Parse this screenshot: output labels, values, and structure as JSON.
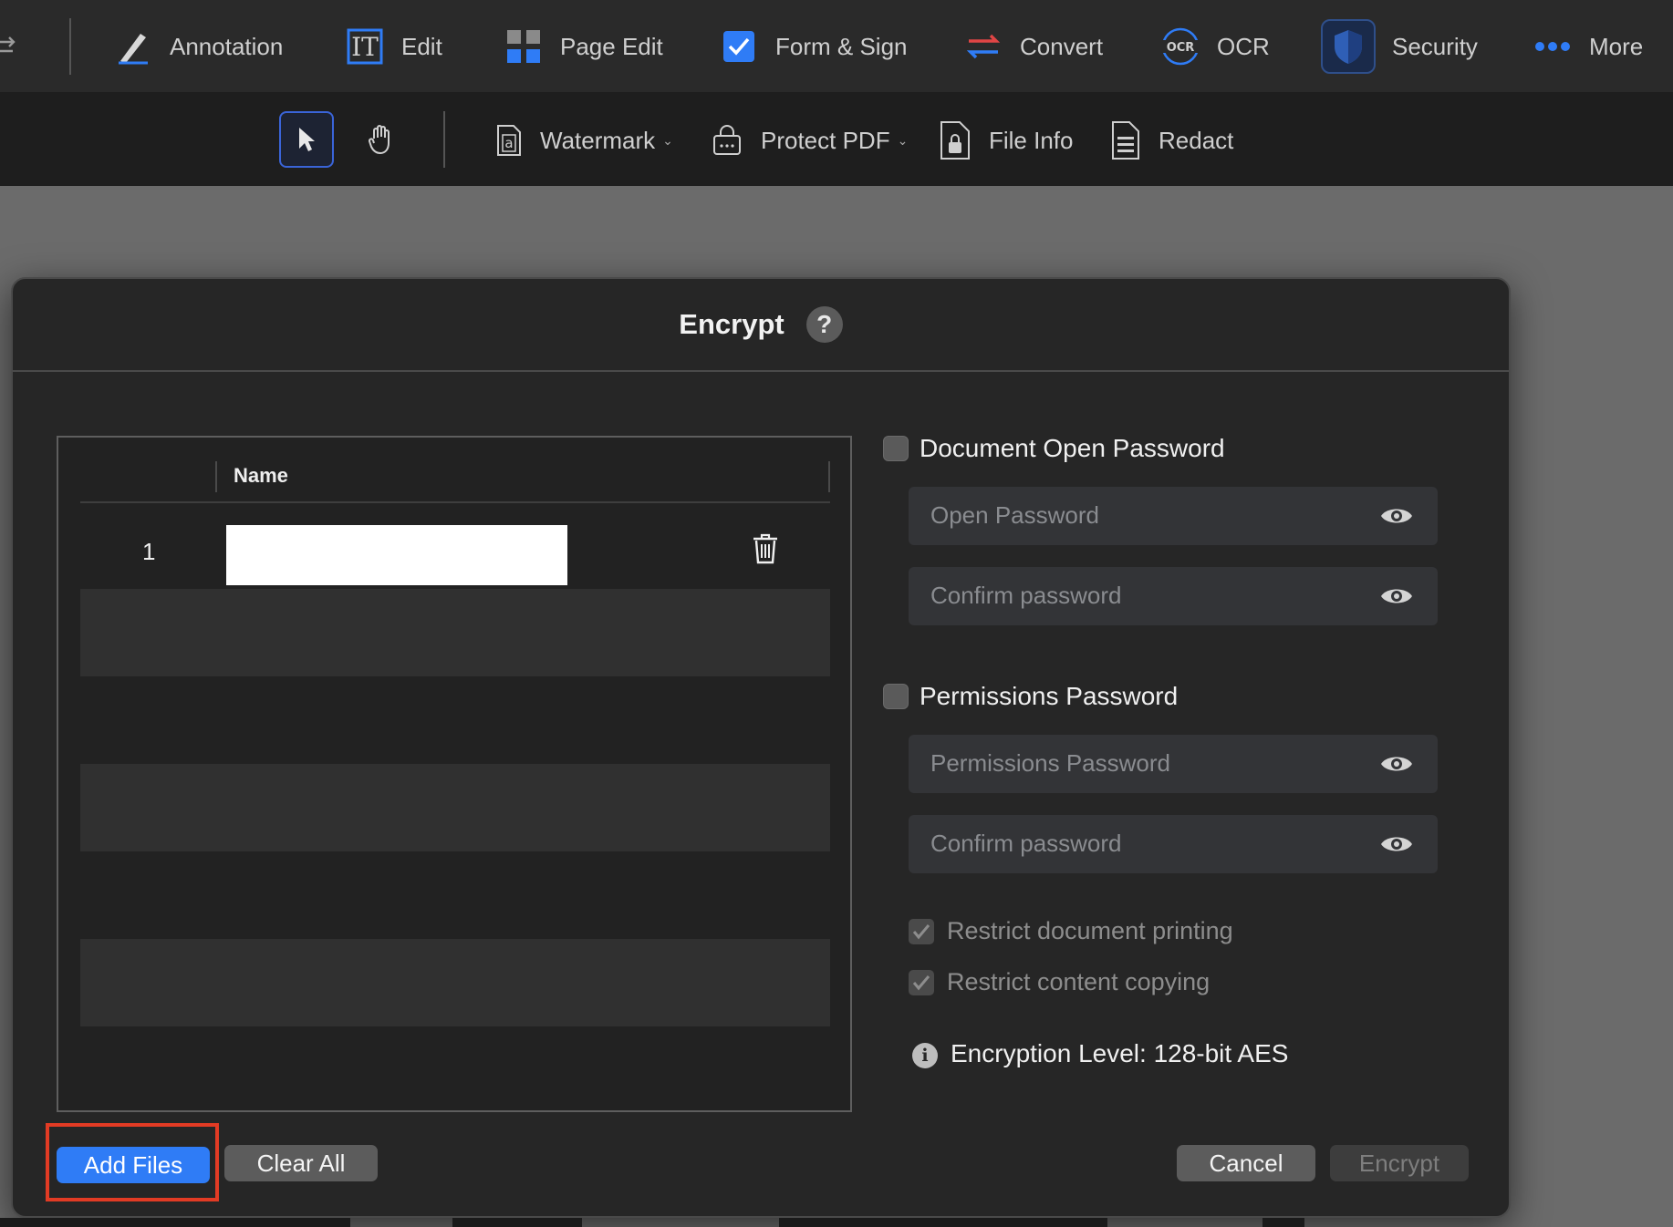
{
  "toolbar": {
    "items": [
      {
        "label": "Annotation",
        "icon": "pen-icon"
      },
      {
        "label": "Edit",
        "icon": "text-edit-icon"
      },
      {
        "label": "Page Edit",
        "icon": "grid-icon"
      },
      {
        "label": "Form & Sign",
        "icon": "checkbox-icon"
      },
      {
        "label": "Convert",
        "icon": "convert-icon"
      },
      {
        "label": "OCR",
        "icon": "ocr-icon",
        "icon_text": "OCR"
      },
      {
        "label": "Security",
        "icon": "shield-icon"
      },
      {
        "label": "More",
        "icon": "more-dots-icon"
      }
    ]
  },
  "subbar": {
    "watermark": "Watermark",
    "protect_pdf": "Protect PDF",
    "file_info": "File Info",
    "redact": "Redact"
  },
  "dialog": {
    "title": "Encrypt",
    "help": "?",
    "table": {
      "column_name": "Name",
      "rows": [
        {
          "index": "1",
          "name": ""
        }
      ]
    },
    "open_password": {
      "label": "Document Open Password",
      "checked": false,
      "placeholder": "Open Password",
      "confirm_placeholder": "Confirm password"
    },
    "permissions_password": {
      "label": "Permissions Password",
      "checked": false,
      "placeholder": "Permissions Password",
      "confirm_placeholder": "Confirm password"
    },
    "restrict_printing": {
      "label": "Restrict document printing",
      "checked": true
    },
    "restrict_copying": {
      "label": "Restrict content copying",
      "checked": true
    },
    "encryption_level": "Encryption Level: 128-bit AES",
    "buttons": {
      "add_files": "Add Files",
      "clear_all": "Clear All",
      "cancel": "Cancel",
      "encrypt": "Encrypt"
    }
  },
  "colors": {
    "accent": "#2f7cf6",
    "highlight": "#e23b24",
    "security_active": "#1a2a4a"
  }
}
